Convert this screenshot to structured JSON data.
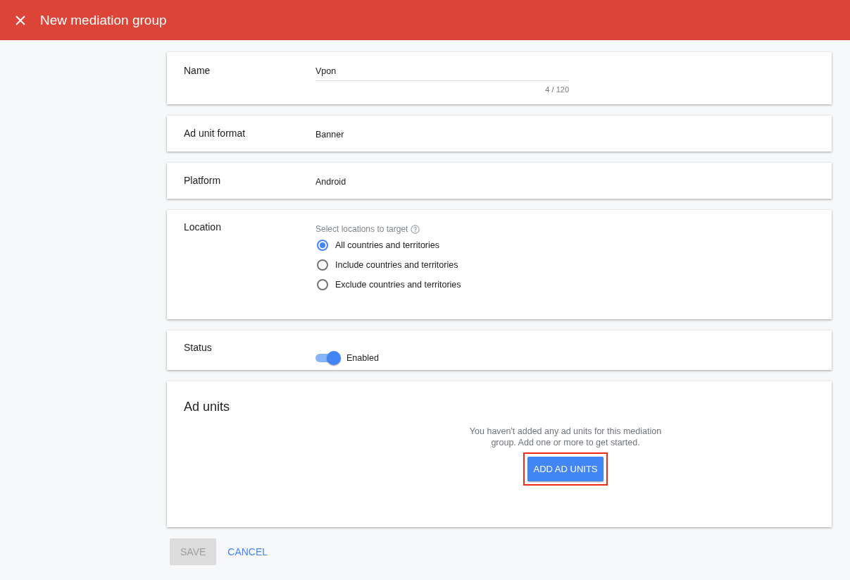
{
  "header": {
    "title": "New mediation group"
  },
  "name_field": {
    "label": "Name",
    "value": "Vpon",
    "counter": "4 / 120"
  },
  "ad_unit_format": {
    "label": "Ad unit format",
    "value": "Banner"
  },
  "platform": {
    "label": "Platform",
    "value": "Android"
  },
  "location": {
    "label": "Location",
    "hint": "Select locations to target",
    "options": [
      {
        "label": "All countries and territories",
        "selected": true
      },
      {
        "label": "Include countries and territories",
        "selected": false
      },
      {
        "label": "Exclude countries and territories",
        "selected": false
      }
    ]
  },
  "status": {
    "label": "Status",
    "on": true,
    "value": "Enabled"
  },
  "ad_units": {
    "title": "Ad units",
    "message": "You haven't added any ad units for this mediation group. Add one or more to get started.",
    "button": {
      "label": "ADD AD UNITS",
      "highlighted": true
    }
  },
  "footer": {
    "save": {
      "label": "SAVE",
      "disabled": true
    },
    "cancel": {
      "label": "CANCEL"
    }
  }
}
